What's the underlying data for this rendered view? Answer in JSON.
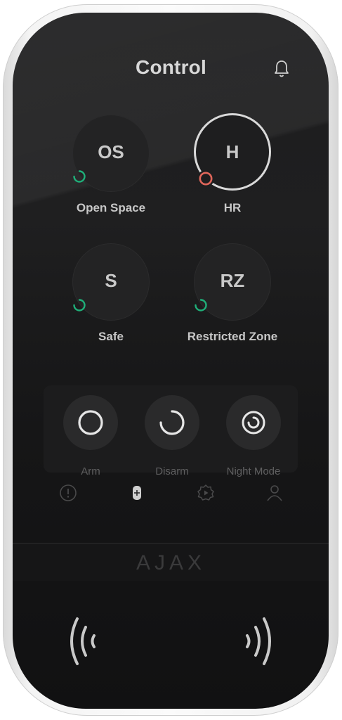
{
  "header": {
    "title": "Control",
    "bell_icon": "bell-icon"
  },
  "groups": [
    {
      "abbr": "OS",
      "label": "Open Space",
      "status": "disarmed",
      "status_color": "#1fb07a"
    },
    {
      "abbr": "H",
      "label": "HR",
      "status": "armed",
      "status_color": "#e0665a"
    },
    {
      "abbr": "S",
      "label": "Safe",
      "status": "disarmed",
      "status_color": "#1fb07a"
    },
    {
      "abbr": "RZ",
      "label": "Restricted Zone",
      "status": "disarmed",
      "status_color": "#1fb07a"
    }
  ],
  "modes": [
    {
      "label": "Arm",
      "icon": "arm-icon"
    },
    {
      "label": "Disarm",
      "icon": "disarm-icon"
    },
    {
      "label": "Night Mode",
      "icon": "night-mode-icon"
    }
  ],
  "nav": [
    {
      "icon": "alert-icon"
    },
    {
      "icon": "keypad-icon",
      "active": true
    },
    {
      "icon": "settings-icon"
    },
    {
      "icon": "user-icon"
    }
  ],
  "brand": {
    "logo": "AJAX"
  }
}
